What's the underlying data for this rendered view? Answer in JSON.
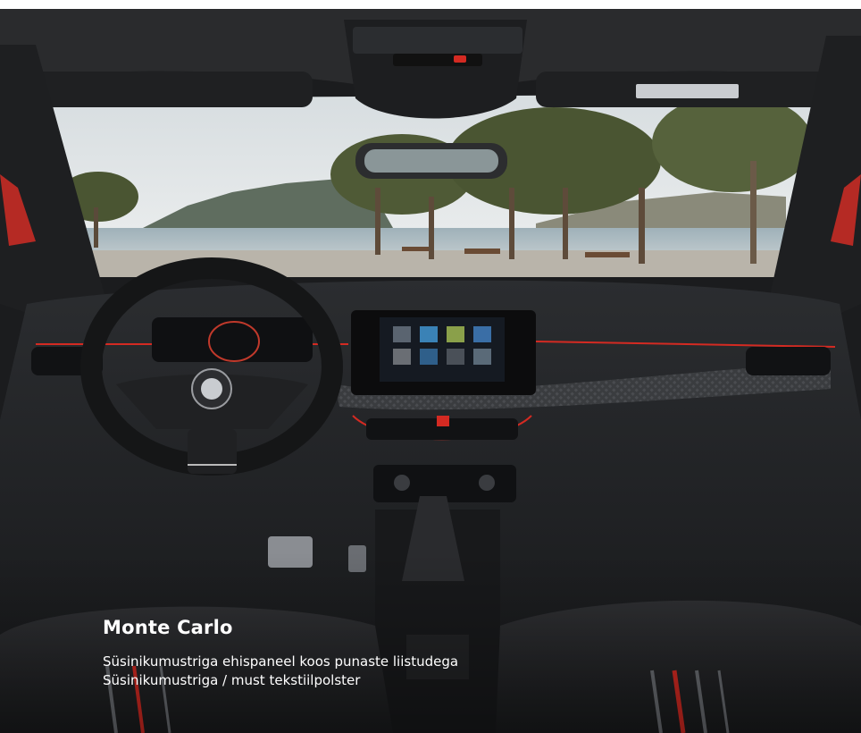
{
  "caption": {
    "title": "Monte Carlo",
    "lines": [
      "Süsinikumustriga ehispaneel koos punaste liistudega",
      "Süsinikumustriga / must tekstiilpolster"
    ]
  },
  "colors": {
    "accent_red": "#d42a22",
    "interior_dark": "#1b1c1e",
    "sky": "#dfe4e6",
    "sea": "#a9b8bf",
    "tree": "#4f5a36"
  }
}
